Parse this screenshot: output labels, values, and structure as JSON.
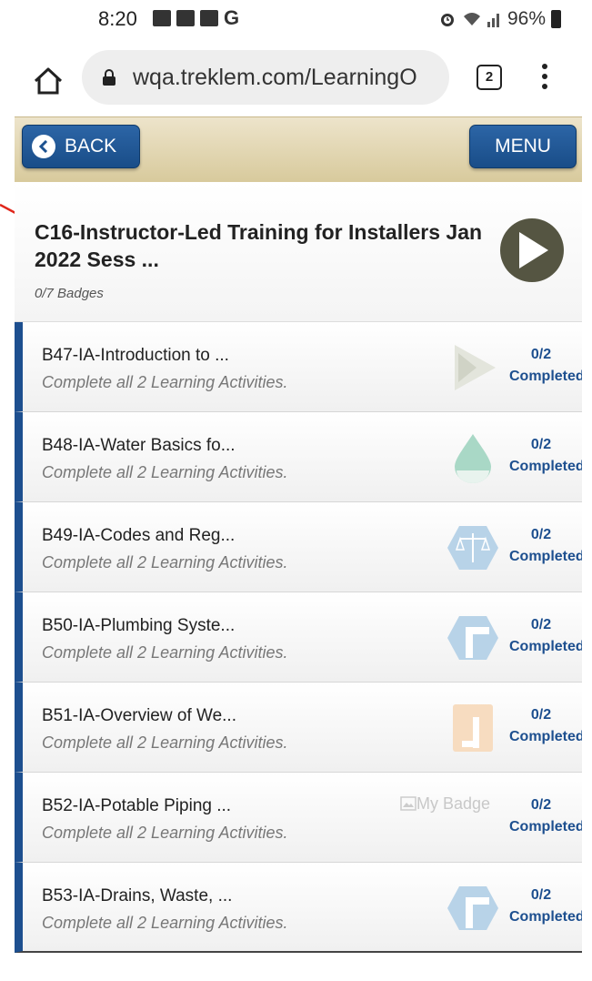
{
  "status_bar": {
    "time": "8:20",
    "battery": "96%"
  },
  "browser": {
    "url": "wqa.treklem.com/LearningO",
    "tab_count": "2"
  },
  "header": {
    "back_label": "BACK",
    "menu_label": "MENU"
  },
  "course": {
    "title": "C16-Instructor-Led Training for Installers Jan 2022 Sess ...",
    "badge_progress": "0/7 Badges"
  },
  "badges": [
    {
      "title": "B47-IA-Introduction to ...",
      "subtitle": "Complete all 2 Learning Activities.",
      "count": "0/2",
      "status": "Completed",
      "icon": "cone-icon",
      "icon_color": "#d9dcd2"
    },
    {
      "title": "B48-IA-Water Basics fo...",
      "subtitle": "Complete all 2 Learning Activities.",
      "count": "0/2",
      "status": "Completed",
      "icon": "water-drop-icon",
      "icon_color": "#a9d8c6"
    },
    {
      "title": "B49-IA-Codes and Reg...",
      "subtitle": "Complete all 2 Learning Activities.",
      "count": "0/2",
      "status": "Completed",
      "icon": "scales-icon",
      "icon_color": "#b8d3e8"
    },
    {
      "title": "B50-IA-Plumbing Syste...",
      "subtitle": "Complete all 2 Learning Activities.",
      "count": "0/2",
      "status": "Completed",
      "icon": "pipe-icon",
      "icon_color": "#b8d3e8"
    },
    {
      "title": "B51-IA-Overview of We...",
      "subtitle": "Complete all 2 Learning Activities.",
      "count": "0/2",
      "status": "Completed",
      "icon": "pipe-orange-icon",
      "icon_color": "#f7dcc0"
    },
    {
      "title": "B52-IA-Potable Piping ...",
      "subtitle": "Complete all 2 Learning Activities.",
      "count": "0/2",
      "status": "Completed",
      "icon": "broken-image",
      "alt": "My Badge"
    },
    {
      "title": "B53-IA-Drains, Waste, ...",
      "subtitle": "Complete all 2 Learning Activities.",
      "count": "0/2",
      "status": "Completed",
      "icon": "pipe-icon",
      "icon_color": "#b8d3e8"
    }
  ],
  "colors": {
    "accent": "#1d4f8f",
    "header_bg": "#e2d6ae",
    "play": "#555542",
    "annotation": "#e0261b"
  }
}
